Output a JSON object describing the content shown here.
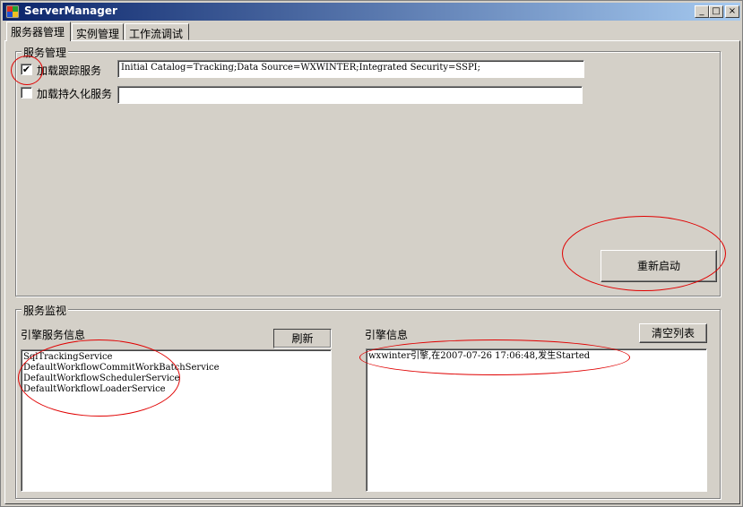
{
  "window": {
    "title": "ServerManager",
    "controls": {
      "minimize": "_",
      "maximize": "□",
      "close": "×"
    }
  },
  "tabs": [
    {
      "label": "服务器管理",
      "active": true
    },
    {
      "label": "实例管理",
      "active": false
    },
    {
      "label": "工作流调试",
      "active": false
    }
  ],
  "service_management": {
    "group_title": "服务管理",
    "tracking": {
      "label": "加载跟踪服务",
      "checked": true,
      "check_glyph": "✔",
      "value": "Initial Catalog=Tracking;Data Source=WXWINTER;Integrated Security=SSPI;"
    },
    "persistence": {
      "label": "加载持久化服务",
      "checked": false,
      "check_glyph": "",
      "value": ""
    },
    "restart_button": "重新启动"
  },
  "service_monitor": {
    "group_title": "服务监视",
    "engine_services": {
      "label": "引擎服务信息",
      "refresh_button": "刷新",
      "items": [
        "SqlTrackingService",
        "DefaultWorkflowCommitWorkBatchService",
        "DefaultWorkflowSchedulerService",
        "DefaultWorkflowLoaderService"
      ]
    },
    "engine_info": {
      "label": "引擎信息",
      "clear_button": "清空列表",
      "items": [
        "wxwinter引擎,在2007-07-26 17:06:48,发生Started"
      ]
    }
  },
  "colors": {
    "annotation": "#e00000",
    "titlebar_start": "#0a246a",
    "titlebar_end": "#a6caf0",
    "face": "#d4d0c8"
  }
}
